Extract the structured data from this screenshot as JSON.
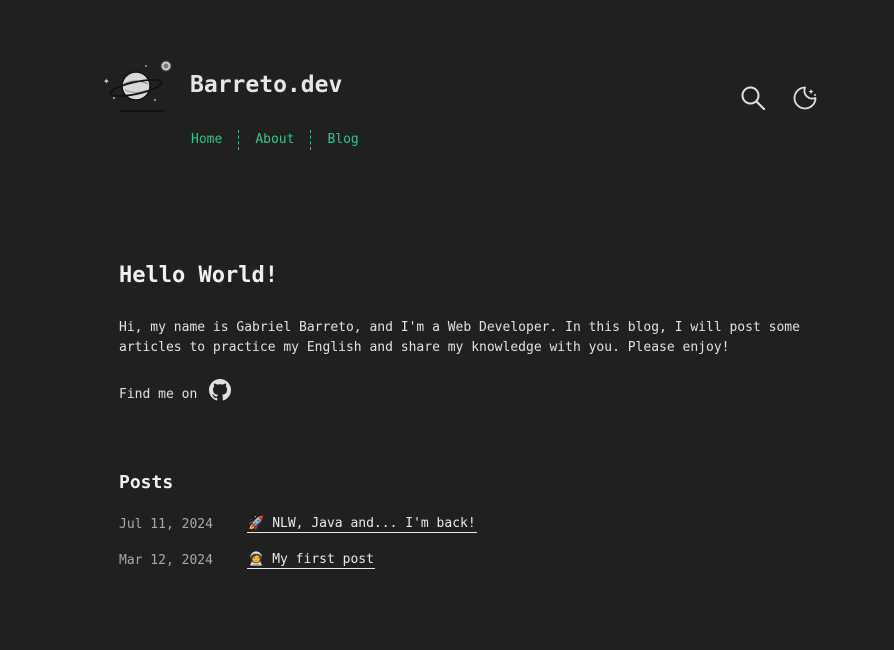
{
  "header": {
    "site_title": "Barreto.dev",
    "logo_icon": "planet-astronaut-logo",
    "nav": [
      {
        "label": "Home"
      },
      {
        "label": "About"
      },
      {
        "label": "Blog"
      }
    ],
    "search_icon": "search-icon",
    "theme_icon": "moon-icon"
  },
  "intro": {
    "title": "Hello World!",
    "text": "Hi, my name is Gabriel Barreto, and I'm a Web Developer. In this blog, I will post some articles to practice my English and share my knowledge with you. Please enjoy!",
    "find_me": "Find me on",
    "social_icon": "github-icon"
  },
  "posts": {
    "title": "Posts",
    "items": [
      {
        "date": "Jul 11, 2024",
        "emoji": "🚀",
        "title": "NLW, Java and... I'm back!"
      },
      {
        "date": "Mar 12, 2024",
        "emoji": "🧑‍🚀",
        "title": "My first post"
      }
    ]
  },
  "colors": {
    "background": "#1f2022",
    "accent": "#3fbf87",
    "text": "#e8e8e8"
  }
}
